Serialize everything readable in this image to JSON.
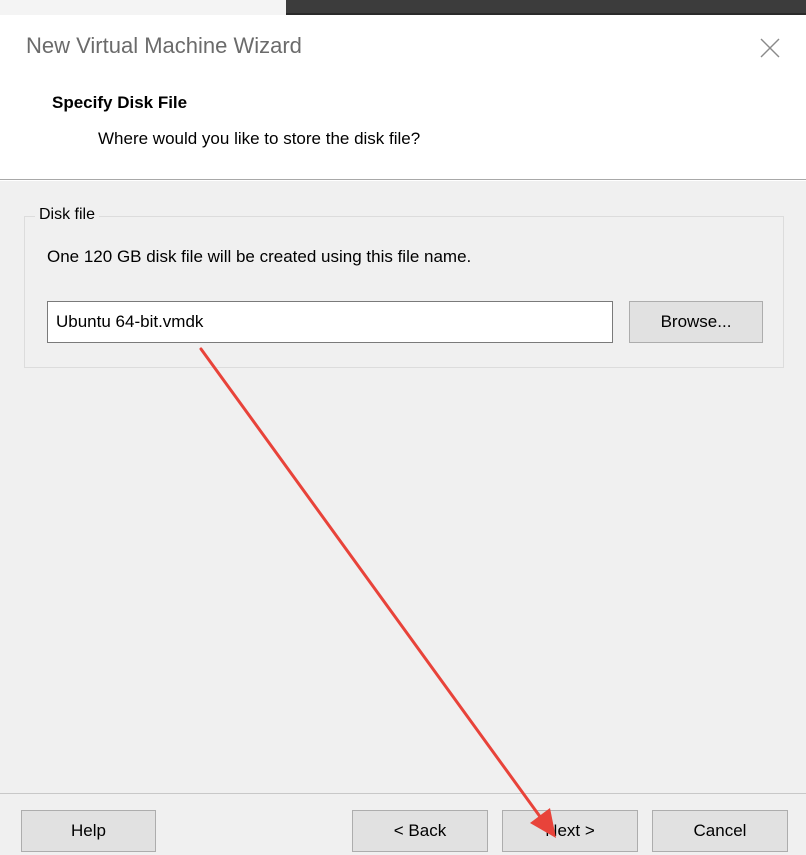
{
  "window": {
    "title": "New Virtual Machine Wizard",
    "close_icon": "close-icon"
  },
  "header": {
    "title": "Specify Disk File",
    "subtitle": "Where would you like to store the disk file?"
  },
  "disk_group": {
    "label": "Disk file",
    "description": "One 120 GB disk file will be created using this file name.",
    "file_name_value": "Ubuntu 64-bit.vmdk",
    "browse_label": "Browse..."
  },
  "footer": {
    "help_label": "Help",
    "back_label": "< Back",
    "next_label": "Next >",
    "cancel_label": "Cancel"
  },
  "annotation": {
    "arrow_color": "#e8433a",
    "points_to": "next-button"
  },
  "colors": {
    "dialog_background": "#f0f0f0",
    "button_background": "#e1e1e1",
    "title_text": "#6b6b6b"
  }
}
